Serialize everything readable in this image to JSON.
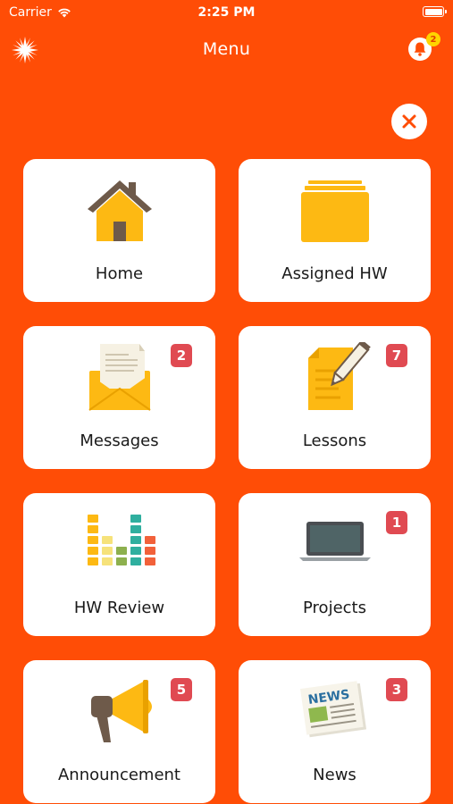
{
  "status_bar": {
    "carrier": "Carrier",
    "time": "2:25 PM"
  },
  "nav": {
    "title": "Menu",
    "notification_count": "2"
  },
  "colors": {
    "background": "#FF4D06",
    "tile": "#FFFFFF",
    "badge": "#E04A52",
    "bell_badge": "#FFD400"
  },
  "menu": {
    "items": [
      {
        "label": "Home",
        "icon": "house-icon",
        "badge": ""
      },
      {
        "label": "Assigned HW",
        "icon": "folder-icon",
        "badge": ""
      },
      {
        "label": "Messages",
        "icon": "envelope-icon",
        "badge": "2"
      },
      {
        "label": "Lessons",
        "icon": "document-pencil-icon",
        "badge": "7"
      },
      {
        "label": "HW Review",
        "icon": "equalizer-chart-icon",
        "badge": ""
      },
      {
        "label": "Projects",
        "icon": "laptop-icon",
        "badge": "1"
      },
      {
        "label": "Announcement",
        "icon": "megaphone-icon",
        "badge": "5"
      },
      {
        "label": "News",
        "icon": "newspaper-icon",
        "badge": "3"
      }
    ],
    "news_icon_text": "NEWS"
  }
}
